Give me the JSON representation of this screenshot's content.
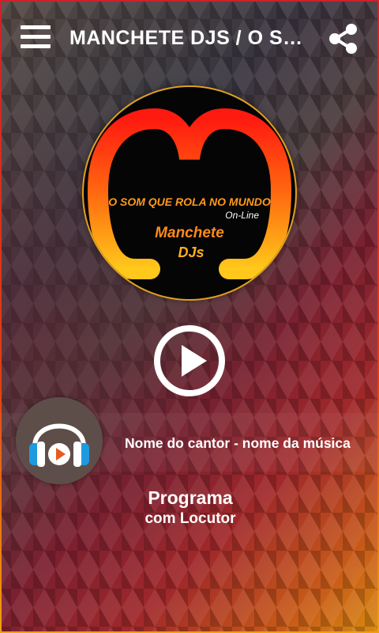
{
  "header": {
    "title": "MANCHETE DJS / O SO...",
    "menu_icon": "hamburger-menu-icon",
    "share_icon": "share-icon"
  },
  "logo": {
    "tagline": "O SOM QUE ROLA NO MUNDO",
    "online": "On-Line",
    "brand_line1": "Manchete",
    "brand_line2": "DJs"
  },
  "player": {
    "play_icon": "play-icon",
    "song": "Nome do cantor - nome da música",
    "program_title": "Programa",
    "program_host": "com Locutor",
    "avatar_icon": "headphones-icon"
  },
  "colors": {
    "logo_red": "#e8201a",
    "logo_yellow": "#ffc21a",
    "text": "#ffffff"
  }
}
